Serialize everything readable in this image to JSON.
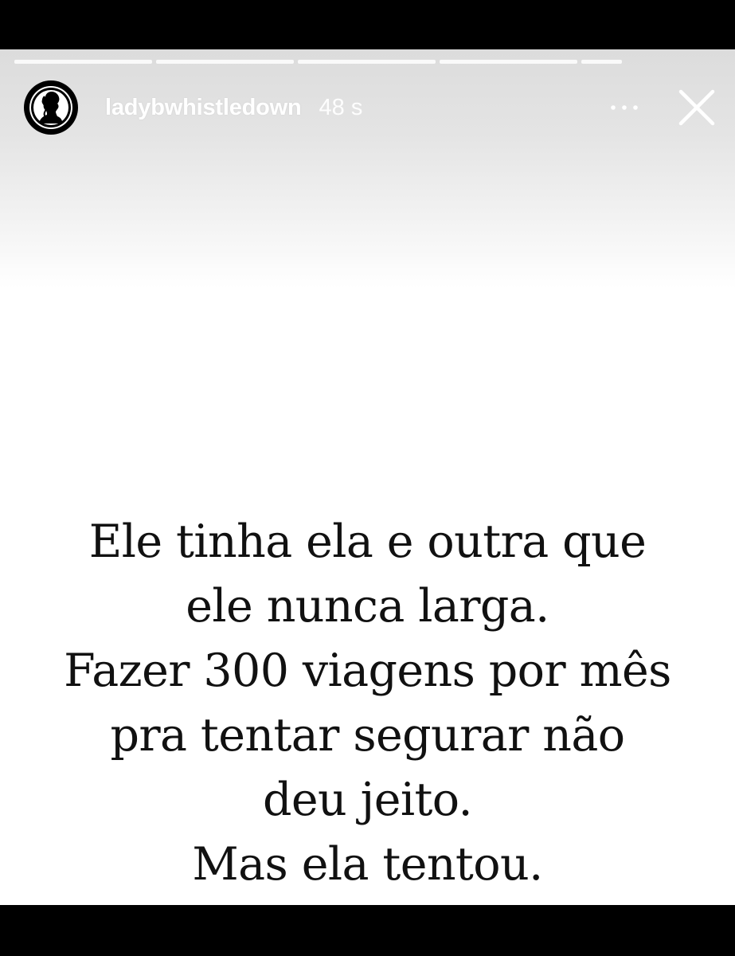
{
  "story": {
    "username": "ladybwhistledown",
    "elapsed": "48 s",
    "progress_segments": [
      1,
      1,
      1,
      1,
      0.3
    ],
    "icons": {
      "avatar": "silhouette-avatar-icon",
      "more": "more-options-icon",
      "close": "close-icon"
    },
    "message_lines": [
      "Ele tinha ela e outra que",
      "ele nunca larga.",
      "Fazer 300 viagens por mês",
      "pra tentar segurar não",
      "deu jeito.",
      "Mas ela tentou."
    ]
  }
}
